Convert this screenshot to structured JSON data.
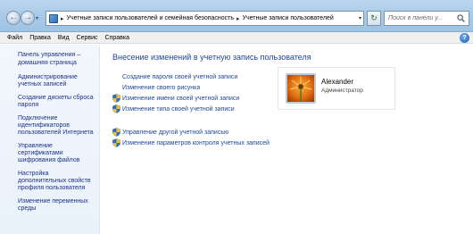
{
  "address": {
    "crumbs": [
      "Учетные записи пользователей и семейная безопасность",
      "Учетные записи пользователей"
    ]
  },
  "search": {
    "placeholder": "Поиск в панели у..."
  },
  "menu": [
    "Файл",
    "Правка",
    "Вид",
    "Сервис",
    "Справка"
  ],
  "left": {
    "home": "Панель управления – домашняя страница",
    "links": [
      "Администрирование учетных записей",
      "Создание дискеты сброса пароля",
      "Подключение идентификаторов пользователей Интернета",
      "Управление сертификатами шифрования файлов",
      "Настройка дополнительных свойств профиля пользователя",
      "Изменение переменных среды"
    ]
  },
  "main": {
    "heading": "Внесение изменений в учетную запись пользователя",
    "tasks_group1": [
      {
        "label": "Создание пароля своей учетной записи",
        "shield": false
      },
      {
        "label": "Изменение своего рисунка",
        "shield": false
      },
      {
        "label": "Изменение имени своей учетной записи",
        "shield": true
      },
      {
        "label": "Изменение типа своей учетной записи",
        "shield": true
      }
    ],
    "tasks_group2": [
      {
        "label": "Управление другой учетной записью",
        "shield": true
      },
      {
        "label": "Изменение параметров контроля учетных записей",
        "shield": true
      }
    ]
  },
  "user": {
    "name": "Alexander",
    "role": "Администратор"
  }
}
